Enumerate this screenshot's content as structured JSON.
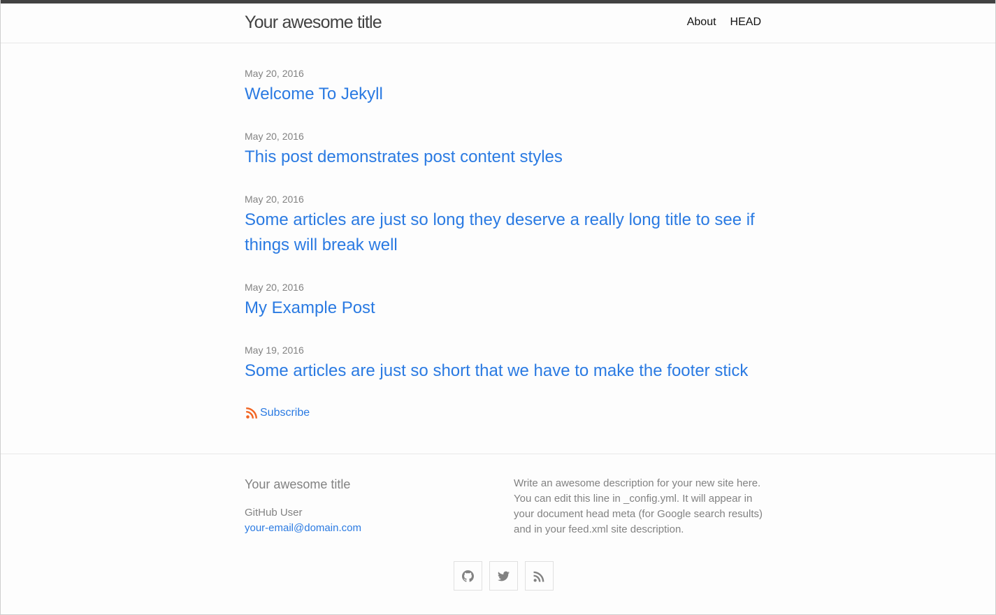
{
  "header": {
    "site_title": "Your awesome title",
    "nav": [
      "About",
      "HEAD"
    ]
  },
  "posts": [
    {
      "date": "May 20, 2016",
      "title": "Welcome To Jekyll"
    },
    {
      "date": "May 20, 2016",
      "title": "This post demonstrates post content styles"
    },
    {
      "date": "May 20, 2016",
      "title": "Some articles are just so long they deserve a really long title to see if things will break well"
    },
    {
      "date": "May 20, 2016",
      "title": "My Example Post"
    },
    {
      "date": "May 19, 2016",
      "title": "Some articles are just so short that we have to make the footer stick"
    }
  ],
  "subscribe": {
    "label": "Subscribe",
    "icon": "rss-icon",
    "icon_color": "#f26522"
  },
  "footer": {
    "heading": "Your awesome title",
    "author": "GitHub User",
    "email": "your-email@domain.com",
    "description": "Write an awesome description for your new site here. You can edit this line in _config.yml. It will appear in your document head meta (for Google search results) and in your feed.xml site description.",
    "social_icons": [
      "github-icon",
      "twitter-icon",
      "rss-icon"
    ]
  },
  "colors": {
    "link": "#2a7ae2",
    "meta": "#828282",
    "header_bar": "#424242"
  }
}
